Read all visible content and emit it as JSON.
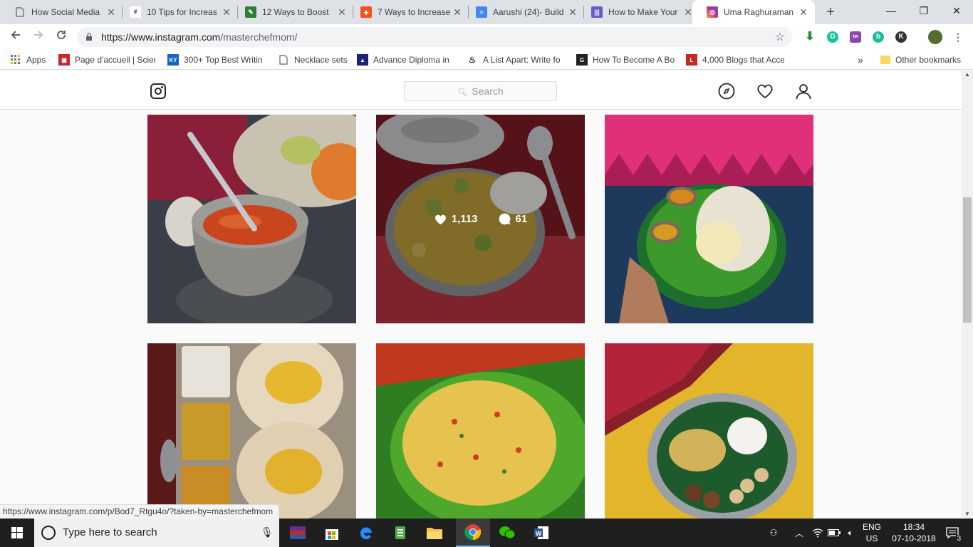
{
  "browser": {
    "tabs": [
      {
        "title": "How Social Media",
        "icon": "page-icon",
        "color": "#5f6368"
      },
      {
        "title": "10 Tips for Increas",
        "icon": "influencer-icon",
        "color": "#202124"
      },
      {
        "title": "12 Ways to Boost",
        "icon": "green-leaf-icon",
        "color": "#2e7d32"
      },
      {
        "title": "7 Ways to Increase",
        "icon": "red-plus-icon",
        "color": "#f4511e"
      },
      {
        "title": "Aarushi (24)- Build",
        "icon": "docs-icon",
        "color": "#4285f4"
      },
      {
        "title": "How to Make Your",
        "icon": "purple-bars-icon",
        "color": "#6a5acd"
      },
      {
        "title": "Uma Raghuraman",
        "icon": "instagram-icon",
        "color": "#c13584"
      }
    ],
    "url_host": "https://www.instagram.com",
    "url_path": "/masterchefmom/",
    "bookmarks": [
      {
        "label": "Apps",
        "icon": "apps-grid-icon"
      },
      {
        "label": "Page d'accueil | Scien",
        "icon": "bookmark-red-icon"
      },
      {
        "label": "300+ Top Best Writin",
        "icon": "ky-icon"
      },
      {
        "label": "Necklace sets",
        "icon": "page-icon"
      },
      {
        "label": "Advance Diploma in",
        "icon": "diploma-icon"
      },
      {
        "label": "A List Apart: Write fo",
        "icon": "alistapart-icon"
      },
      {
        "label": "How To Become A Bo",
        "icon": "g-icon"
      },
      {
        "label": "4,000 Blogs that Acce",
        "icon": "blogs-icon"
      }
    ],
    "other_bookmarks": "Other bookmarks",
    "status_url": "https://www.instagram.com/p/Bod7_Rtgu4o/?taken-by=masterchefmom"
  },
  "instagram": {
    "search_placeholder": "Search",
    "hover_post": {
      "likes": "1,113",
      "comments": "61"
    }
  },
  "taskbar": {
    "search_placeholder": "Type here to search",
    "lang_top": "ENG",
    "lang_bottom": "US",
    "time": "18:34",
    "date": "07-10-2018",
    "notification_count": "3"
  },
  "colors": {
    "tab_bar": "#dee1e6",
    "taskbar": "#1f1f1f",
    "ig_border": "#dbdbdb"
  }
}
